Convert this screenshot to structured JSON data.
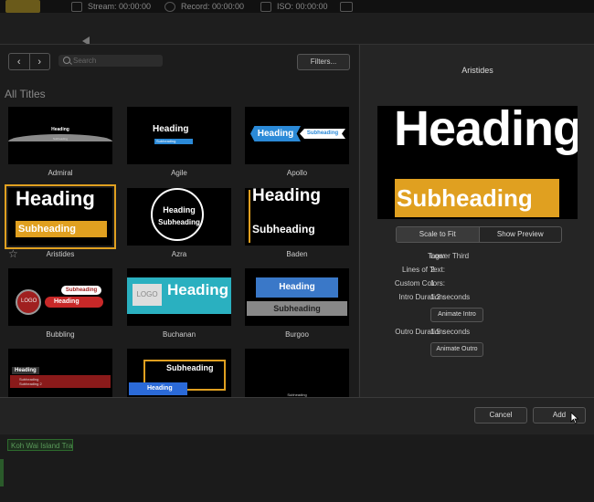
{
  "topbar": {
    "stream_label": "Stream:",
    "stream_time": "00:00:00",
    "record_label": "Record:",
    "record_time": "00:00:00",
    "iso_label": "ISO:",
    "iso_time": "00:00:00"
  },
  "toolbar": {
    "search_placeholder": "Search",
    "filters_label": "Filters..."
  },
  "browser": {
    "section_title": "All Titles",
    "tiles": [
      {
        "name": "Admiral",
        "heading": "Heading",
        "sub": "Subheading"
      },
      {
        "name": "Agile",
        "heading": "Heading",
        "sub": "Subheading"
      },
      {
        "name": "Apollo",
        "heading": "Heading",
        "sub": "Subheading"
      },
      {
        "name": "Aristides",
        "heading": "Heading",
        "sub": "Subheading",
        "selected": true
      },
      {
        "name": "Azra",
        "heading": "Heading",
        "sub": "Subheading"
      },
      {
        "name": "Baden",
        "heading": "Heading",
        "sub": "Subheading"
      },
      {
        "name": "Bubbling",
        "heading": "Heading",
        "sub": "Subheading",
        "logo": "LOGO"
      },
      {
        "name": "Buchanan",
        "heading": "Heading",
        "logo": "LOGO"
      },
      {
        "name": "Burgoo",
        "heading": "Heading",
        "sub": "Subheading"
      }
    ],
    "partial_row": [
      {
        "heading": "Heading",
        "sub": "Subheading",
        "sub2": "Subheading 2"
      },
      {
        "heading": "Heading",
        "sub": "Subheading"
      },
      {
        "sub": "Subheading"
      }
    ]
  },
  "detail": {
    "title": "Aristides",
    "preview_heading": "Heading",
    "preview_sub": "Subheading",
    "scale_to_fit": "Scale to Fit",
    "show_preview": "Show Preview",
    "tags_label": "Tags:",
    "tags_value": "Lower Third",
    "lines_label": "Lines of Text:",
    "lines_value": "2",
    "colors_label": "Custom Colors:",
    "colors_value": "1",
    "intro_label": "Intro Duration:",
    "intro_value": "1.2 seconds",
    "animate_intro": "Animate Intro",
    "outro_label": "Outro Duration:",
    "outro_value": "1.5 seconds",
    "animate_outro": "Animate Outro"
  },
  "footer": {
    "cancel_label": "Cancel",
    "add_label": "Add"
  },
  "background": {
    "clip_label": "Koh Wai Island Trail"
  },
  "colors": {
    "accent": "#e0a020",
    "blue": "#2b8ad8"
  }
}
